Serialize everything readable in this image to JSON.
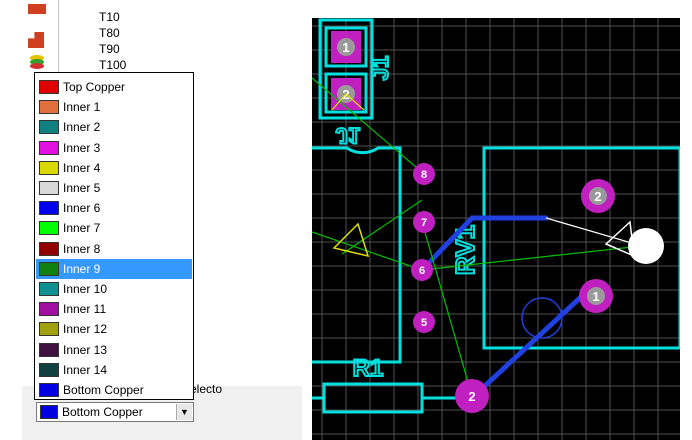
{
  "track_list": {
    "items": [
      "T10",
      "T80",
      "T90",
      "T100"
    ]
  },
  "layer_dropdown": {
    "items": [
      {
        "label": "Top Copper",
        "color": "#e00000"
      },
      {
        "label": "Inner 1",
        "color": "#e07040"
      },
      {
        "label": "Inner 2",
        "color": "#108080"
      },
      {
        "label": "Inner 3",
        "color": "#e010e0"
      },
      {
        "label": "Inner 4",
        "color": "#d8d800"
      },
      {
        "label": "Inner 5",
        "color": "#d8d8d8"
      },
      {
        "label": "Inner 6",
        "color": "#0000f0"
      },
      {
        "label": "Inner 7",
        "color": "#00ff00"
      },
      {
        "label": "Inner 8",
        "color": "#900000"
      },
      {
        "label": "Inner 9",
        "color": "#108010"
      },
      {
        "label": "Inner 10",
        "color": "#109090"
      },
      {
        "label": "Inner 11",
        "color": "#a010a0"
      },
      {
        "label": "Inner 12",
        "color": "#a0a010"
      },
      {
        "label": "Inner 13",
        "color": "#401040"
      },
      {
        "label": "Inner 14",
        "color": "#104040"
      },
      {
        "label": "Bottom Copper",
        "color": "#0000e0"
      }
    ],
    "selected_label": "Inner 9"
  },
  "layer_combo": {
    "value": "Bottom Copper",
    "color": "#0000e0"
  },
  "side_label": "electo",
  "pcb": {
    "background": "#000000",
    "grid_color": "#505050",
    "silk_color": "#00e0e0",
    "pad_color": "#c020c0",
    "track_color": "#2040e0",
    "ratsnest_color": "#00c000",
    "designators": {
      "j1": "J1",
      "rv1": "RV1",
      "r1": "R1"
    },
    "pads": {
      "j1_p1": "1",
      "j1_p2": "2",
      "rv1_p8": "8",
      "rv1_p7": "7",
      "rv1_p6": "6",
      "rv1_p5": "5",
      "right_p2": "2",
      "right_p1": "1",
      "r1_p2": "2"
    }
  }
}
